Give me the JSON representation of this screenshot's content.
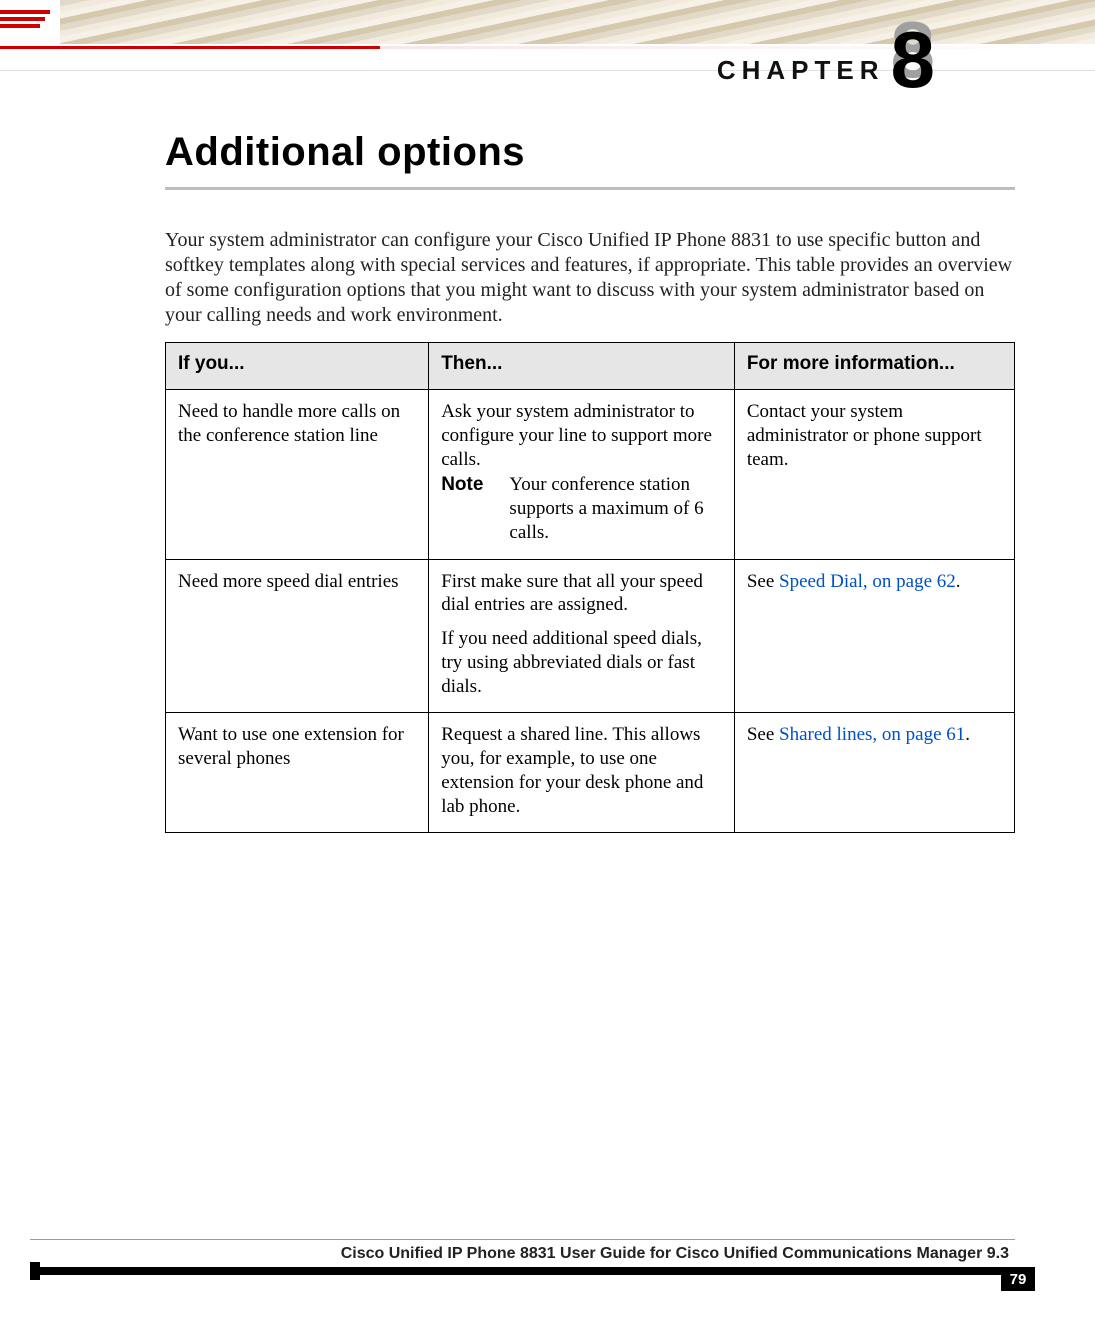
{
  "header": {
    "chapter_word": "CHAPTER",
    "chapter_number": "8"
  },
  "title": "Additional options",
  "intro": "Your system administrator can configure your Cisco Unified IP Phone 8831 to use specific button and softkey templates along with special services and features, if appropriate. This table provides an overview of some configuration options that you might want to discuss with your system administrator based on your calling needs and work environment.",
  "table": {
    "headers": {
      "c1": "If you...",
      "c2": "Then...",
      "c3": "For more information..."
    },
    "rows": [
      {
        "c1": "Need to handle more calls on the conference station line",
        "c2_p1": "Ask your system administrator to configure your line to support more calls.",
        "c2_note_label": "Note",
        "c2_note_body": "Your conference station supports a maximum of 6 calls.",
        "c3": "Contact your system administrator or phone support team."
      },
      {
        "c1": "Need more speed dial entries",
        "c2_p1": "First make sure that all your speed dial entries are assigned.",
        "c2_p2": "If you need additional speed dials, try using abbreviated dials or fast dials.",
        "c3_prefix": "See ",
        "c3_link": "Speed Dial,  on page 62",
        "c3_suffix": "."
      },
      {
        "c1": "Want to use one extension for several phones",
        "c2_p1": "Request a shared line. This allows you, for example, to use one extension for your desk phone and lab phone.",
        "c3_prefix": "See ",
        "c3_link": "Shared lines,  on page 61",
        "c3_suffix": "."
      }
    ]
  },
  "footer": {
    "doc_title": "Cisco Unified IP Phone 8831 User Guide for Cisco Unified Communications Manager 9.3",
    "page_number": "79"
  }
}
